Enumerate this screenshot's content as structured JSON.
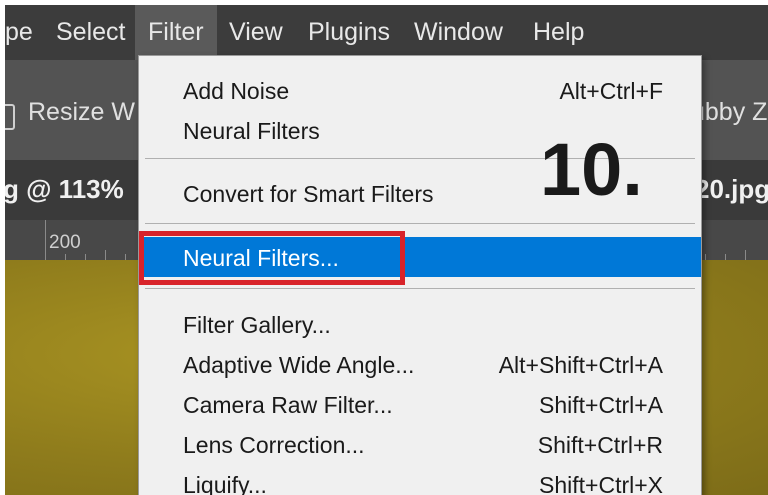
{
  "menubar": {
    "items": [
      {
        "label": "pe"
      },
      {
        "label": "Select"
      },
      {
        "label": "Filter"
      },
      {
        "label": "View"
      },
      {
        "label": "Plugins"
      },
      {
        "label": "Window"
      },
      {
        "label": "Help"
      }
    ]
  },
  "options_bar": {
    "left_text": "Resize W",
    "right_text": "ubby Z"
  },
  "document_tabs": {
    "left": "g @ 113%",
    "right": "20.jpg"
  },
  "ruler": {
    "label": "200"
  },
  "filter_menu": {
    "items": [
      {
        "label": "Add Noise",
        "shortcut": "Alt+Ctrl+F"
      },
      {
        "label": "Neural Filters",
        "shortcut": ""
      },
      {
        "label": "Convert for Smart Filters",
        "shortcut": ""
      },
      {
        "label": "Neural Filters...",
        "shortcut": "",
        "highlighted": true
      },
      {
        "label": "Filter Gallery...",
        "shortcut": ""
      },
      {
        "label": "Adaptive Wide Angle...",
        "shortcut": "Alt+Shift+Ctrl+A"
      },
      {
        "label": "Camera Raw Filter...",
        "shortcut": "Shift+Ctrl+A"
      },
      {
        "label": "Lens Correction...",
        "shortcut": "Shift+Ctrl+R"
      },
      {
        "label": "Liquify...",
        "shortcut": "Shift+Ctrl+X"
      }
    ]
  },
  "annotation": {
    "step": "10.",
    "highlight_color": "#d8232a"
  },
  "colors": {
    "menu_highlight": "#0078d7",
    "canvas": "#8f7c1c",
    "menubar": "#3c3c3c"
  }
}
